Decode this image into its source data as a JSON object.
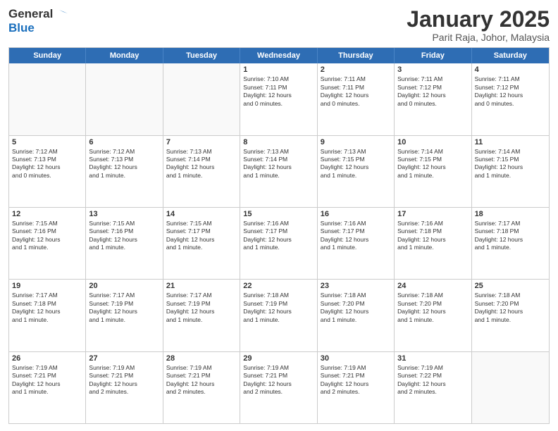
{
  "logo": {
    "line1": "General",
    "line2": "Blue"
  },
  "title": "January 2025",
  "subtitle": "Parit Raja, Johor, Malaysia",
  "header_days": [
    "Sunday",
    "Monday",
    "Tuesday",
    "Wednesday",
    "Thursday",
    "Friday",
    "Saturday"
  ],
  "weeks": [
    [
      {
        "day": "",
        "info": ""
      },
      {
        "day": "",
        "info": ""
      },
      {
        "day": "",
        "info": ""
      },
      {
        "day": "1",
        "info": "Sunrise: 7:10 AM\nSunset: 7:11 PM\nDaylight: 12 hours\nand 0 minutes."
      },
      {
        "day": "2",
        "info": "Sunrise: 7:11 AM\nSunset: 7:11 PM\nDaylight: 12 hours\nand 0 minutes."
      },
      {
        "day": "3",
        "info": "Sunrise: 7:11 AM\nSunset: 7:12 PM\nDaylight: 12 hours\nand 0 minutes."
      },
      {
        "day": "4",
        "info": "Sunrise: 7:11 AM\nSunset: 7:12 PM\nDaylight: 12 hours\nand 0 minutes."
      }
    ],
    [
      {
        "day": "5",
        "info": "Sunrise: 7:12 AM\nSunset: 7:13 PM\nDaylight: 12 hours\nand 0 minutes."
      },
      {
        "day": "6",
        "info": "Sunrise: 7:12 AM\nSunset: 7:13 PM\nDaylight: 12 hours\nand 1 minute."
      },
      {
        "day": "7",
        "info": "Sunrise: 7:13 AM\nSunset: 7:14 PM\nDaylight: 12 hours\nand 1 minute."
      },
      {
        "day": "8",
        "info": "Sunrise: 7:13 AM\nSunset: 7:14 PM\nDaylight: 12 hours\nand 1 minute."
      },
      {
        "day": "9",
        "info": "Sunrise: 7:13 AM\nSunset: 7:15 PM\nDaylight: 12 hours\nand 1 minute."
      },
      {
        "day": "10",
        "info": "Sunrise: 7:14 AM\nSunset: 7:15 PM\nDaylight: 12 hours\nand 1 minute."
      },
      {
        "day": "11",
        "info": "Sunrise: 7:14 AM\nSunset: 7:15 PM\nDaylight: 12 hours\nand 1 minute."
      }
    ],
    [
      {
        "day": "12",
        "info": "Sunrise: 7:15 AM\nSunset: 7:16 PM\nDaylight: 12 hours\nand 1 minute."
      },
      {
        "day": "13",
        "info": "Sunrise: 7:15 AM\nSunset: 7:16 PM\nDaylight: 12 hours\nand 1 minute."
      },
      {
        "day": "14",
        "info": "Sunrise: 7:15 AM\nSunset: 7:17 PM\nDaylight: 12 hours\nand 1 minute."
      },
      {
        "day": "15",
        "info": "Sunrise: 7:16 AM\nSunset: 7:17 PM\nDaylight: 12 hours\nand 1 minute."
      },
      {
        "day": "16",
        "info": "Sunrise: 7:16 AM\nSunset: 7:17 PM\nDaylight: 12 hours\nand 1 minute."
      },
      {
        "day": "17",
        "info": "Sunrise: 7:16 AM\nSunset: 7:18 PM\nDaylight: 12 hours\nand 1 minute."
      },
      {
        "day": "18",
        "info": "Sunrise: 7:17 AM\nSunset: 7:18 PM\nDaylight: 12 hours\nand 1 minute."
      }
    ],
    [
      {
        "day": "19",
        "info": "Sunrise: 7:17 AM\nSunset: 7:18 PM\nDaylight: 12 hours\nand 1 minute."
      },
      {
        "day": "20",
        "info": "Sunrise: 7:17 AM\nSunset: 7:19 PM\nDaylight: 12 hours\nand 1 minute."
      },
      {
        "day": "21",
        "info": "Sunrise: 7:17 AM\nSunset: 7:19 PM\nDaylight: 12 hours\nand 1 minute."
      },
      {
        "day": "22",
        "info": "Sunrise: 7:18 AM\nSunset: 7:19 PM\nDaylight: 12 hours\nand 1 minute."
      },
      {
        "day": "23",
        "info": "Sunrise: 7:18 AM\nSunset: 7:20 PM\nDaylight: 12 hours\nand 1 minute."
      },
      {
        "day": "24",
        "info": "Sunrise: 7:18 AM\nSunset: 7:20 PM\nDaylight: 12 hours\nand 1 minute."
      },
      {
        "day": "25",
        "info": "Sunrise: 7:18 AM\nSunset: 7:20 PM\nDaylight: 12 hours\nand 1 minute."
      }
    ],
    [
      {
        "day": "26",
        "info": "Sunrise: 7:19 AM\nSunset: 7:21 PM\nDaylight: 12 hours\nand 1 minute."
      },
      {
        "day": "27",
        "info": "Sunrise: 7:19 AM\nSunset: 7:21 PM\nDaylight: 12 hours\nand 2 minutes."
      },
      {
        "day": "28",
        "info": "Sunrise: 7:19 AM\nSunset: 7:21 PM\nDaylight: 12 hours\nand 2 minutes."
      },
      {
        "day": "29",
        "info": "Sunrise: 7:19 AM\nSunset: 7:21 PM\nDaylight: 12 hours\nand 2 minutes."
      },
      {
        "day": "30",
        "info": "Sunrise: 7:19 AM\nSunset: 7:21 PM\nDaylight: 12 hours\nand 2 minutes."
      },
      {
        "day": "31",
        "info": "Sunrise: 7:19 AM\nSunset: 7:22 PM\nDaylight: 12 hours\nand 2 minutes."
      },
      {
        "day": "",
        "info": ""
      }
    ]
  ]
}
